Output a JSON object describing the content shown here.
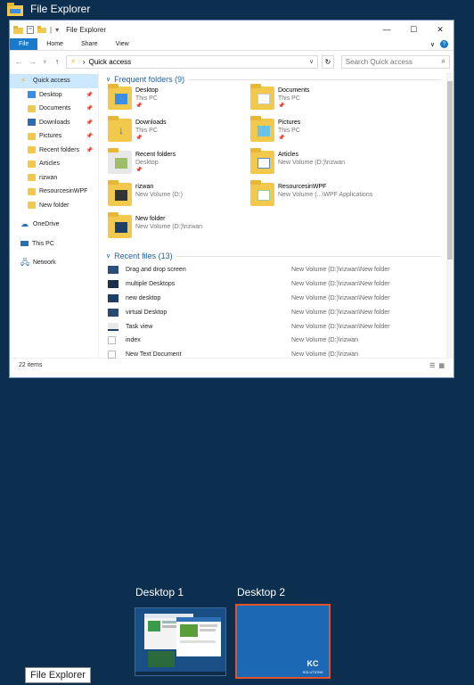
{
  "topbar": {
    "title": "File Explorer"
  },
  "window": {
    "title": "File Explorer",
    "quick_access_toolbar": [
      "|",
      "▾"
    ],
    "controls": {
      "minimize": "—",
      "maximize": "☐",
      "close": "✕"
    },
    "ribbon": {
      "tabs": [
        "File",
        "Home",
        "Share",
        "View"
      ],
      "expand": "∨",
      "help": "?"
    },
    "address": {
      "back": "←",
      "forward": "→",
      "recent": "∨",
      "up": "↑",
      "separator": "›",
      "path": "Quick access",
      "dropdown": "∨",
      "refresh": "↻",
      "search_placeholder": "Search Quick access"
    },
    "nav": {
      "items": [
        {
          "label": "Quick access",
          "icon": "lightning-icon",
          "active": true
        },
        {
          "label": "Desktop",
          "pinned": true
        },
        {
          "label": "Documents",
          "pinned": true
        },
        {
          "label": "Downloads",
          "pinned": true
        },
        {
          "label": "Pictures",
          "pinned": true
        },
        {
          "label": "Recent folders",
          "pinned": true
        },
        {
          "label": "Articles"
        },
        {
          "label": "rizwan"
        },
        {
          "label": "ResourcesinWPF"
        },
        {
          "label": "New folder"
        },
        {
          "label": "OneDrive",
          "icon": "cloud-icon"
        },
        {
          "label": "This PC",
          "icon": "computer-icon"
        },
        {
          "label": "Network",
          "icon": "network-icon"
        }
      ]
    },
    "frequent": {
      "header": "Frequent folders (9)",
      "folders": [
        {
          "name": "Desktop",
          "location": "This PC",
          "pin": "📌"
        },
        {
          "name": "Documents",
          "location": "This PC",
          "pin": "📌"
        },
        {
          "name": "Downloads",
          "location": "This PC",
          "pin": "📌"
        },
        {
          "name": "Pictures",
          "location": "This PC",
          "pin": "📌"
        },
        {
          "name": "Recent folders",
          "location": "Desktop",
          "pin": "📌"
        },
        {
          "name": "Articles",
          "location": "New Volume (D:)\\rizwan"
        },
        {
          "name": "rizwan",
          "location": "New Volume (D:)"
        },
        {
          "name": "ResourcesinWPF",
          "location": "New Volume (...\\WPF Applications"
        },
        {
          "name": "New folder",
          "location": "New Volume (D:)\\rizwan"
        }
      ]
    },
    "recent": {
      "header": "Recent files (13)",
      "files": [
        {
          "name": "Drag and drop screen",
          "location": "New Volume (D:)\\rizwan\\New folder"
        },
        {
          "name": "multiple Desktops",
          "location": "New Volume (D:)\\rizwan\\New folder"
        },
        {
          "name": "new desktop",
          "location": "New Volume (D:)\\rizwan\\New folder"
        },
        {
          "name": "virtual Desktop",
          "location": "New Volume (D:)\\rizwan\\New folder"
        },
        {
          "name": "Task view",
          "location": "New Volume (D:)\\rizwan\\New folder"
        },
        {
          "name": "index",
          "location": "New Volume (D:)\\rizwan"
        },
        {
          "name": "New Text Document",
          "location": "New Volume (D:)\\rizwan"
        }
      ]
    },
    "status": {
      "items": "22 items"
    }
  },
  "desktops": [
    {
      "label": "Desktop 1",
      "selected": false
    },
    {
      "label": "Desktop 2",
      "selected": true
    }
  ],
  "logo_text": "KC",
  "logo_sub": "SOLUTIONS",
  "tooltip": "File Explorer",
  "colors": {
    "background": "#0c2f4f",
    "accent": "#1979ca",
    "folder": "#f2c94c",
    "selection": "#e0532b"
  }
}
